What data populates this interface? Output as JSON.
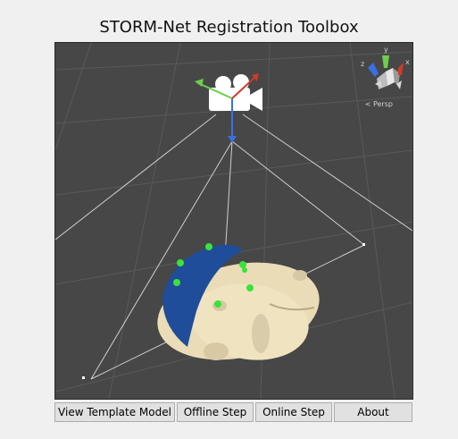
{
  "window": {
    "title": "STORM-Net Registration Toolbox"
  },
  "viewport": {
    "projection_label": "Persp",
    "gizmo_axes": {
      "x": "x",
      "y": "y",
      "z": "z"
    },
    "background_color": "#474747"
  },
  "buttons": [
    {
      "label": "View Template Model"
    },
    {
      "label": "Offline Step"
    },
    {
      "label": "Online Step"
    },
    {
      "label": "About"
    }
  ]
}
